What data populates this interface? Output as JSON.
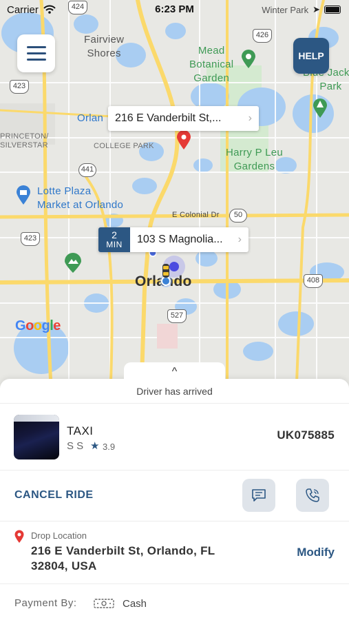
{
  "status_bar": {
    "carrier": "Carrier",
    "time": "6:23 PM",
    "overlay_text": "Winter Park"
  },
  "map": {
    "labels": {
      "fairview": "Fairview\nShores",
      "mead": "Mead\nBotanical\nGarden",
      "blue_jacket": "Blue Jacket\nPark",
      "princeton": "PRINCETON/\nSILVERSTAR",
      "college_park": "COLLEGE PARK",
      "orlando_partial": "Orlan",
      "harry": "Harry P Leu\nGardens",
      "lotte": "Lotte Plaza\nMarket at Orlando",
      "colonial": "E Colonial Dr",
      "city": "Orlando"
    },
    "shields": {
      "s424": "424",
      "s426": "426",
      "s423a": "423",
      "s441": "441",
      "s50": "50",
      "s423b": "423",
      "s408": "408",
      "s527": "527"
    },
    "google": "Google"
  },
  "callouts": {
    "destination": "216 E Vanderbilt St,...",
    "pickup": "103 S Magnolia...",
    "eta_num": "2",
    "eta_unit": "MIN"
  },
  "buttons": {
    "help": "HELP"
  },
  "sheet": {
    "caret": "^",
    "status": "Driver has arrived",
    "driver": {
      "vehicle_type": "TAXI",
      "name": "S S",
      "rating": "3.9",
      "plate": "UK075885"
    },
    "cancel_label": "CANCEL RIDE",
    "drop": {
      "label": "Drop Location",
      "address": "216 E Vanderbilt St, Orlando, FL 32804, USA",
      "modify_label": "Modify"
    },
    "payment": {
      "label": "Payment By:",
      "method": "Cash"
    }
  },
  "colors": {
    "accent": "#2c5783",
    "pin_red": "#e53935",
    "map_bg": "#e8e8e4",
    "water": "#a9cdf2",
    "park": "#cfe8c9",
    "road": "#fbd96b"
  }
}
